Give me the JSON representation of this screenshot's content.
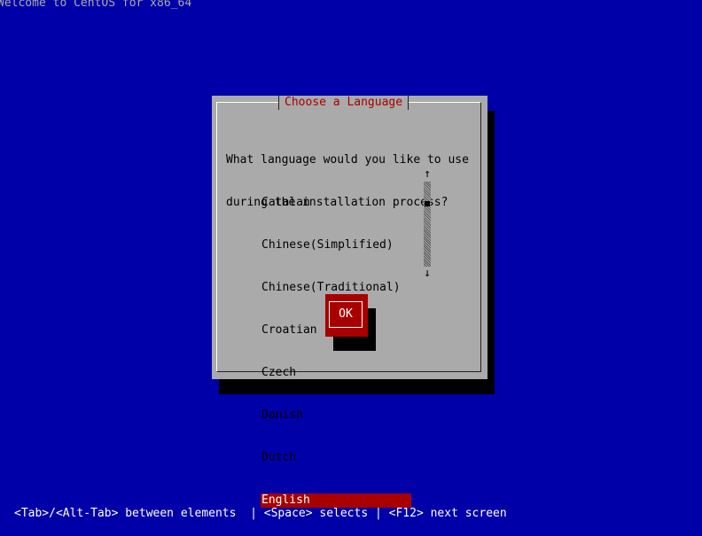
{
  "screen": {
    "title": "Welcome to CentOS for x86_64"
  },
  "dialog": {
    "title": "Choose a Language",
    "prompt_line1": "What language would you like to use",
    "prompt_line2": "during the installation process?",
    "languages": [
      {
        "label": "Catalan",
        "selected": false
      },
      {
        "label": "Chinese(Simplified)",
        "selected": false
      },
      {
        "label": "Chinese(Traditional)",
        "selected": false
      },
      {
        "label": "Croatian",
        "selected": false
      },
      {
        "label": "Czech",
        "selected": false
      },
      {
        "label": "Danish",
        "selected": false
      },
      {
        "label": "Dutch",
        "selected": false
      },
      {
        "label": "English",
        "selected": true
      }
    ],
    "scroll_up_glyph": "↑",
    "scroll_down_glyph": "↓",
    "ok_label": "OK"
  },
  "status_bar": {
    "text": "<Tab>/<Alt-Tab> between elements  | <Space> selects | <F12> next screen"
  },
  "colors": {
    "background": "#0000a8",
    "dialog": "#aaaaaa",
    "accent": "#a80000",
    "shadow": "#000000"
  }
}
